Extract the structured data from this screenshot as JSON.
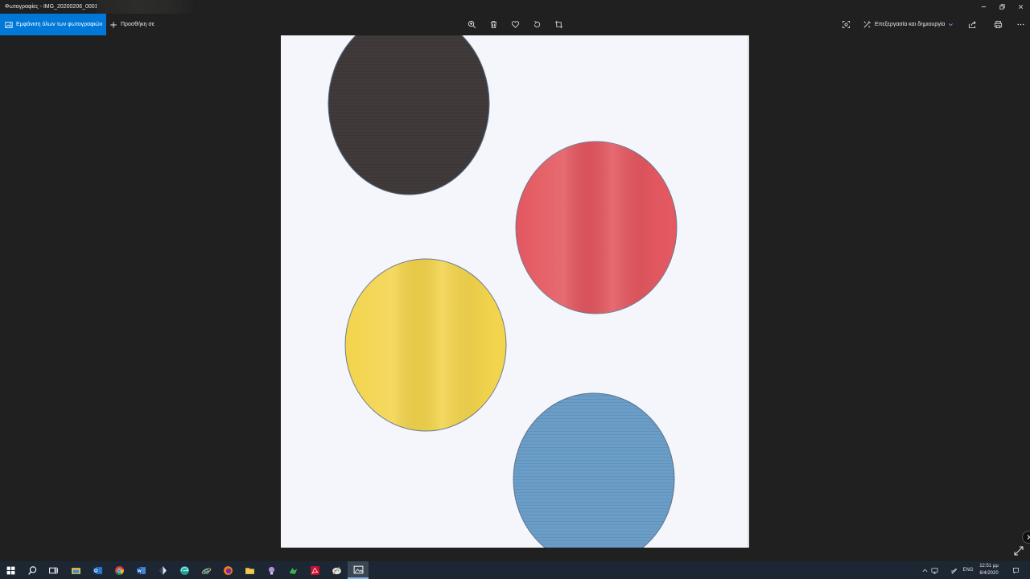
{
  "window": {
    "title": "Φωτογραφίες - IMG_20200206_0001.jpg"
  },
  "toolbar": {
    "view_all_label": "Εμφάνιση όλων των φωτογραφιών",
    "add_to_label": "Προσθήκη σε",
    "edit_create_label": "Επεξεργασία και δημιουργία",
    "accent_color": "#0078d7"
  },
  "photo": {
    "background_color": "#f4f6fb",
    "circles": [
      {
        "name": "black-circle",
        "color": "#403b3a"
      },
      {
        "name": "red-circle",
        "color": "#e4575f"
      },
      {
        "name": "yellow-circle",
        "color": "#f3d44c"
      },
      {
        "name": "blue-circle",
        "color": "#6a9ec8"
      }
    ]
  },
  "taskbar": {
    "apps": [
      "start",
      "search",
      "task-view",
      "file-explorer",
      "outlook",
      "chrome",
      "word",
      "app-diamond",
      "edge",
      "internet-explorer",
      "firefox",
      "file-manager",
      "app-bulb",
      "app-green",
      "acrobat",
      "app-paint",
      "photos"
    ],
    "language": "ENG",
    "time": "12:51 μμ",
    "date": "6/4/2020"
  }
}
